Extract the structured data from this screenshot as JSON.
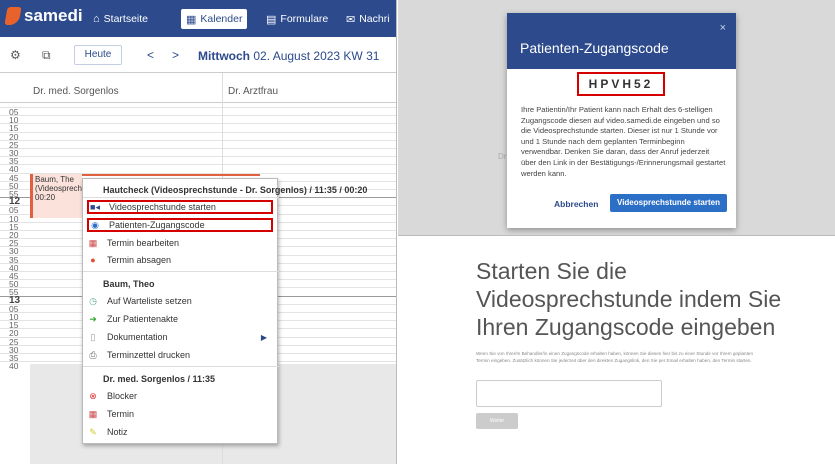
{
  "app": {
    "logo_text": "samedi",
    "nav": [
      {
        "icon": "home-icon",
        "label": "Startseite"
      },
      {
        "icon": "calendar-icon",
        "label": "Kalender"
      },
      {
        "icon": "form-icon",
        "label": "Formulare"
      },
      {
        "icon": "mail-icon",
        "label": "Nachri"
      }
    ]
  },
  "toolbar": {
    "today_label": "Heute",
    "prev": "<",
    "next": ">",
    "date_day": "Mittwoch",
    "date_rest": "02. August 2023 KW 31"
  },
  "columns": [
    "Dr. med. Sorgenlos",
    "Dr. Arztfrau"
  ],
  "time_rows": [
    {
      "label": "05"
    },
    {
      "label": "10"
    },
    {
      "label": "15"
    },
    {
      "label": "20"
    },
    {
      "label": "25"
    },
    {
      "label": "30"
    },
    {
      "label": "35"
    },
    {
      "label": "40"
    },
    {
      "label": "45"
    },
    {
      "label": "50"
    },
    {
      "label": "55"
    },
    {
      "label": "12",
      "hour": true
    },
    {
      "label": "05"
    },
    {
      "label": "10"
    },
    {
      "label": "15"
    },
    {
      "label": "20"
    },
    {
      "label": "25"
    },
    {
      "label": "30"
    },
    {
      "label": "35"
    },
    {
      "label": "40"
    },
    {
      "label": "45"
    },
    {
      "label": "50"
    },
    {
      "label": "55"
    },
    {
      "label": "13",
      "hour": true
    },
    {
      "label": "05"
    },
    {
      "label": "10"
    },
    {
      "label": "15"
    },
    {
      "label": "20"
    },
    {
      "label": "25"
    },
    {
      "label": "30"
    },
    {
      "label": "35"
    },
    {
      "label": "40"
    }
  ],
  "appointment": {
    "line1": "Baum, The",
    "line2": "(Videosprechs",
    "line3": "00:20"
  },
  "context_menu": {
    "title": "Hautcheck (Videosprechstunde - Dr. Sorgenlos) / 11:35 / 00:20",
    "items": [
      {
        "icon": "video-camera-icon",
        "label": "Videosprechstunde starten",
        "highlight": true
      },
      {
        "icon": "eye-icon",
        "label": "Patienten-Zugangscode",
        "highlight": true
      },
      {
        "icon": "calendar-edit-icon",
        "label": "Termin bearbeiten"
      },
      {
        "icon": "cancel-icon",
        "label": "Termin absagen"
      }
    ],
    "patient_title": "Baum, Theo",
    "patient_items": [
      {
        "icon": "waitlist-icon",
        "label": "Auf Warteliste setzen"
      },
      {
        "icon": "arrow-right-icon",
        "label": "Zur Patientenakte"
      },
      {
        "icon": "document-icon",
        "label": "Dokumentation",
        "submenu": true
      },
      {
        "icon": "printer-icon",
        "label": "Terminzettel drucken"
      }
    ],
    "doctor_title": "Dr. med. Sorgenlos / 11:35",
    "doctor_items": [
      {
        "icon": "blocker-icon",
        "label": "Blocker"
      },
      {
        "icon": "calendar-add-icon",
        "label": "Termin"
      },
      {
        "icon": "note-icon",
        "label": "Notiz"
      }
    ]
  },
  "modal": {
    "title": "Patienten-Zugangscode",
    "close": "×",
    "code": "HPVH52",
    "text": "Ihre Patientin/Ihr Patient kann nach Erhalt des 6-stelligen Zugangscode diesen auf video.samedi.de eingeben und so die Videosprechstunde starten. Dieser ist nur 1 Stunde vor und 1 Stunde nach dem geplanten Terminbeginn verwendbar. Denken Sie daran, dass der Anruf jederzeit über den Link in der Bestätigungs-/Erinnerungsmail gestartet werden kann.",
    "cancel_label": "Abbrechen",
    "start_label": "Videosprechstunde starten",
    "background_fragment": "Dr"
  },
  "patient_page": {
    "heading": "Starten Sie die Videosprechstunde indem Sie Ihren Zugangscode eingeben",
    "text": "Wenn Sie von Ihrer/m Behandler/in einen Zugangscode erhalten haben, können Sie diesen hier bis zu einer Stunde vor Ihrem geplanten Termin eingeben. Zusätzlich können Sie jederzeit über den direkten Zugangslink, den Sie per Email erhalten haben, den Termin starten.",
    "button_label": "Weiter"
  },
  "colors": {
    "brand": "#2c4a8c",
    "accent": "#e8632b",
    "highlight": "#d40000",
    "primary_button": "#2c6fc7"
  }
}
